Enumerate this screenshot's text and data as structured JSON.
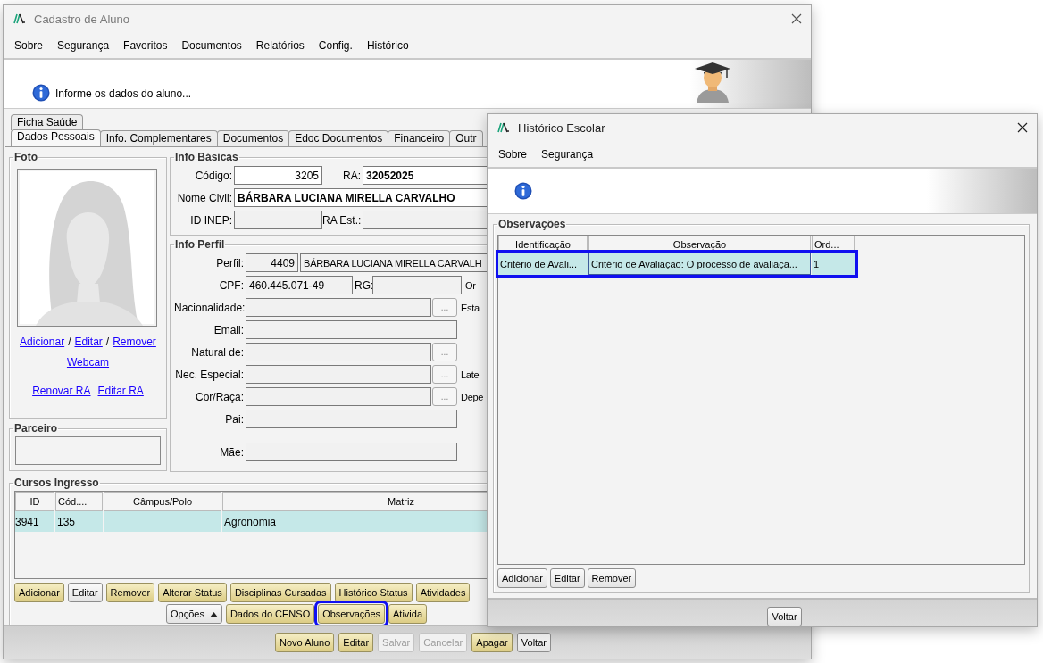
{
  "main_window": {
    "title": "Cadastro de Aluno",
    "menu": [
      "Sobre",
      "Segurança",
      "Favoritos",
      "Documentos",
      "Relatórios",
      "Config.",
      "Histórico"
    ],
    "message": "Informe os dados do aluno...",
    "tabs_top": [
      {
        "label": "Ficha Saúde",
        "selected": false
      }
    ],
    "tabs": [
      {
        "label": "Dados Pessoais",
        "selected": true
      },
      {
        "label": "Info. Complementares",
        "selected": false
      },
      {
        "label": "Documentos",
        "selected": false
      },
      {
        "label": "Edoc Documentos",
        "selected": false
      },
      {
        "label": "Financeiro",
        "selected": false
      },
      {
        "label": "Outr",
        "selected": false
      }
    ],
    "foto": {
      "title": "Foto",
      "links": [
        "Adicionar",
        "Editar",
        "Remover"
      ],
      "separators": [
        "/",
        "/"
      ],
      "webcam": "Webcam",
      "ra_links": [
        "Renovar RA",
        "Editar RA"
      ]
    },
    "parceiro": {
      "title": "Parceiro"
    },
    "info_basicas": {
      "title": "Info Básicas",
      "codigo_label": "Código:",
      "codigo": "3205",
      "ra_label": "RA:",
      "ra": "32052025",
      "nome_label": "Nome Civil:",
      "nome": "BÁRBARA LUCIANA MIRELLA CARVALHO",
      "inep_label": "ID INEP:",
      "ra_est_label": "RA Est.:"
    },
    "info_perfil": {
      "title": "Info Perfil",
      "rows": [
        {
          "kind": "perfil",
          "label": "Perfil:",
          "id": "4409",
          "name": "BÁRBARA LUCIANA MIRELLA CARVALH"
        },
        {
          "kind": "cpf",
          "label": "CPF:",
          "value": "460.445.071-49",
          "rg_label": "RG:",
          "side_label": "Or"
        },
        {
          "kind": "lookup",
          "label": "Nacionalidade:",
          "button": "...",
          "side_label": "Esta"
        },
        {
          "kind": "text",
          "label": "Email:"
        },
        {
          "kind": "lookup",
          "label": "Natural de:",
          "button": "..."
        },
        {
          "kind": "lookup",
          "label": "Nec. Especial:",
          "button": "...",
          "side_label": "Late"
        },
        {
          "kind": "lookup",
          "label": "Cor/Raça:",
          "button": "...",
          "side_label": "Depe"
        },
        {
          "kind": "text",
          "label": "Pai:"
        },
        {
          "kind": "text",
          "label": "Mãe:"
        }
      ]
    },
    "cursos": {
      "title": "Cursos Ingresso",
      "columns": [
        "ID",
        "Cód....",
        "Câmpus/Polo",
        "Matriz"
      ],
      "rows": [
        {
          "id": "3941",
          "cod": "135",
          "matriz": "Agronomia",
          "selected": true
        }
      ],
      "buttons_row1": [
        {
          "label": "Adicionar",
          "kind": "gold",
          "highlighted": false
        },
        {
          "label": "Editar",
          "kind": "plain",
          "highlighted": false
        },
        {
          "label": "Remover",
          "kind": "gold",
          "highlighted": false
        },
        {
          "label": "Alterar Status",
          "kind": "gold",
          "highlighted": false
        },
        {
          "label": "Disciplinas Cursadas",
          "kind": "gold",
          "highlighted": false
        },
        {
          "label": "Histórico Status",
          "kind": "gold",
          "highlighted": false
        },
        {
          "label": "Atividades",
          "kind": "gold",
          "highlighted": false
        }
      ],
      "buttons_row2": [
        {
          "label": "Opções",
          "kind": "dropdown",
          "highlighted": false
        },
        {
          "label": "Dados do CENSO",
          "kind": "gold",
          "highlighted": false
        },
        {
          "label": "Observações",
          "kind": "gold",
          "highlighted": true
        },
        {
          "label": "Ativida",
          "kind": "gold",
          "highlighted": false
        }
      ]
    },
    "footer_buttons": [
      {
        "label": "Novo Aluno",
        "kind": "gold",
        "disabled": false
      },
      {
        "label": "Editar",
        "kind": "gold",
        "disabled": false
      },
      {
        "label": "Salvar",
        "kind": "gold",
        "disabled": true
      },
      {
        "label": "Cancelar",
        "kind": "gold",
        "disabled": true
      },
      {
        "label": "Apagar",
        "kind": "gold",
        "disabled": false
      },
      {
        "label": "Voltar",
        "kind": "plain",
        "disabled": false
      }
    ]
  },
  "dialog": {
    "title": "Histórico Escolar",
    "menu": [
      "Sobre",
      "Segurança"
    ],
    "group": "Observações",
    "columns": [
      "Identificação",
      "Observação",
      "Ord..."
    ],
    "rows": [
      {
        "identificacao": "Critério de Avali...",
        "observacao": "Critério de Avaliação: O processo de avaliaçã...",
        "ordem": "1",
        "selected": true,
        "highlighted": true
      }
    ],
    "buttons": [
      "Adicionar",
      "Editar",
      "Remover"
    ],
    "footer_button": "Voltar"
  }
}
